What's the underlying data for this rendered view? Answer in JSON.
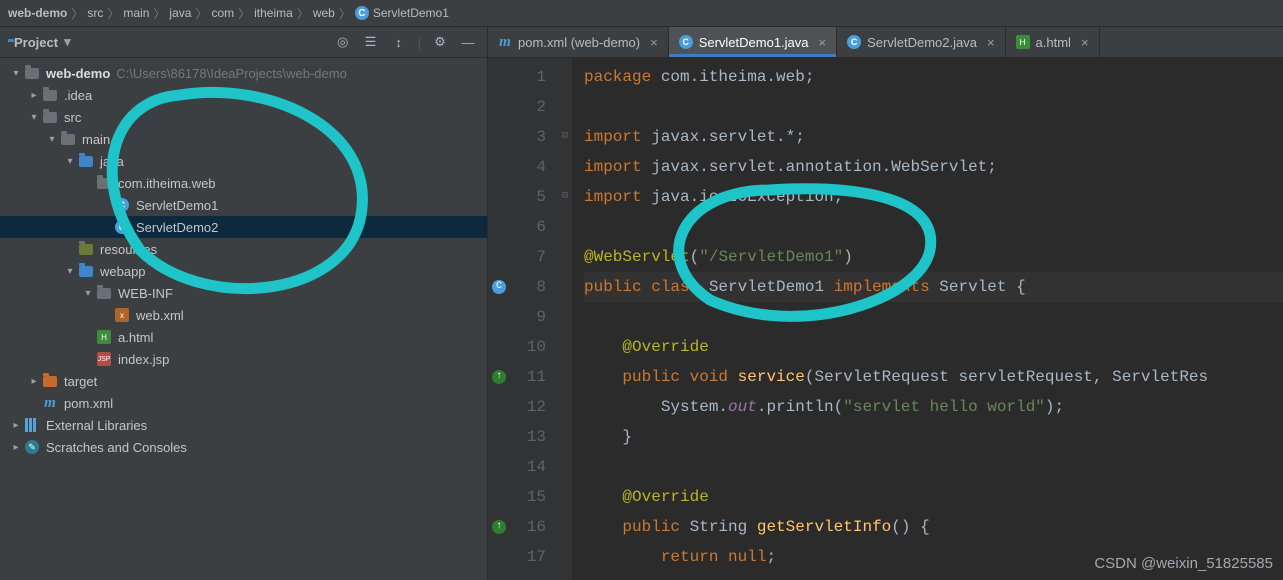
{
  "breadcrumb": [
    "web-demo",
    "src",
    "main",
    "java",
    "com",
    "itheima",
    "web",
    "ServletDemo1"
  ],
  "breadcrumb_last_icon": "class-icon",
  "project": {
    "title": "Project",
    "toolbar_icons": [
      "target-icon",
      "sort-icon",
      "expand-icon",
      "gear-icon",
      "hide-icon"
    ]
  },
  "tree": {
    "root": {
      "label": "web-demo",
      "path": "C:\\Users\\86178\\IdeaProjects\\web-demo"
    },
    "idea": ".idea",
    "src": "src",
    "main": "main",
    "java": "java",
    "pkg": "com.itheima.web",
    "cls1": "ServletDemo1",
    "cls2": "ServletDemo2",
    "resources": "resources",
    "webapp": "webapp",
    "webinf": "WEB-INF",
    "webxml": "web.xml",
    "ahtml": "a.html",
    "indexjsp": "index.jsp",
    "target": "target",
    "pom": "pom.xml",
    "ext": "External Libraries",
    "scratch": "Scratches and Consoles"
  },
  "tabs": [
    {
      "label": "pom.xml (web-demo)",
      "icon": "maven-icon",
      "active": false
    },
    {
      "label": "ServletDemo1.java",
      "icon": "class-icon",
      "active": true
    },
    {
      "label": "ServletDemo2.java",
      "icon": "class-icon",
      "active": false
    },
    {
      "label": "a.html",
      "icon": "html-icon",
      "active": false
    }
  ],
  "code": {
    "lines": [
      {
        "n": 1,
        "segs": [
          {
            "t": "package ",
            "c": "k"
          },
          {
            "t": "com.itheima.web;",
            "c": "c"
          }
        ]
      },
      {
        "n": 2,
        "segs": []
      },
      {
        "n": 3,
        "segs": [
          {
            "t": "import ",
            "c": "k"
          },
          {
            "t": "javax.servlet.*;",
            "c": "c"
          }
        ],
        "fold": "open"
      },
      {
        "n": 4,
        "segs": [
          {
            "t": "import ",
            "c": "k"
          },
          {
            "t": "javax.servlet.annotation.WebServlet;",
            "c": "c"
          }
        ]
      },
      {
        "n": 5,
        "segs": [
          {
            "t": "import ",
            "c": "k"
          },
          {
            "t": "java.io.IOException;",
            "c": "c"
          }
        ],
        "fold": "close"
      },
      {
        "n": 6,
        "segs": []
      },
      {
        "n": 7,
        "segs": [
          {
            "t": "@WebServlet",
            "c": "a"
          },
          {
            "t": "(",
            "c": "c"
          },
          {
            "t": "\"/ServletDemo1\"",
            "c": "s"
          },
          {
            "t": ")",
            "c": "c"
          }
        ]
      },
      {
        "n": 8,
        "segs": [
          {
            "t": "public class ",
            "c": "k"
          },
          {
            "t": "ServletDemo1 ",
            "c": "c"
          },
          {
            "t": "implements ",
            "c": "k"
          },
          {
            "t": "Servlet ",
            "c": "c"
          },
          {
            "t": "{",
            "c": "c"
          }
        ],
        "cur": true,
        "mark": "class"
      },
      {
        "n": 9,
        "segs": []
      },
      {
        "n": 10,
        "segs": [
          {
            "t": "    ",
            "c": "c"
          },
          {
            "t": "@Override",
            "c": "a"
          }
        ]
      },
      {
        "n": 11,
        "segs": [
          {
            "t": "    ",
            "c": "c"
          },
          {
            "t": "public ",
            "c": "k"
          },
          {
            "t": "void ",
            "c": "k"
          },
          {
            "t": "service",
            "c": "n"
          },
          {
            "t": "(ServletRequest servletRequest, ServletRes",
            "c": "c"
          }
        ],
        "mark": "warn"
      },
      {
        "n": 12,
        "segs": [
          {
            "t": "        System.",
            "c": "c"
          },
          {
            "t": "out",
            "c": "f"
          },
          {
            "t": ".println(",
            "c": "c"
          },
          {
            "t": "\"servlet hello world\"",
            "c": "s"
          },
          {
            "t": ");",
            "c": "c"
          }
        ]
      },
      {
        "n": 13,
        "segs": [
          {
            "t": "    }",
            "c": "c"
          }
        ]
      },
      {
        "n": 14,
        "segs": []
      },
      {
        "n": 15,
        "segs": [
          {
            "t": "    ",
            "c": "c"
          },
          {
            "t": "@Override",
            "c": "a"
          }
        ]
      },
      {
        "n": 16,
        "segs": [
          {
            "t": "    ",
            "c": "c"
          },
          {
            "t": "public ",
            "c": "k"
          },
          {
            "t": "String ",
            "c": "c"
          },
          {
            "t": "getServletInfo",
            "c": "n"
          },
          {
            "t": "() {",
            "c": "c"
          }
        ],
        "mark": "warn"
      },
      {
        "n": 17,
        "segs": [
          {
            "t": "        ",
            "c": "c"
          },
          {
            "t": "return null",
            "c": "k"
          },
          {
            "t": ";",
            "c": "c"
          }
        ],
        "partial": true
      }
    ]
  },
  "watermark": "CSDN @weixin_51825585"
}
